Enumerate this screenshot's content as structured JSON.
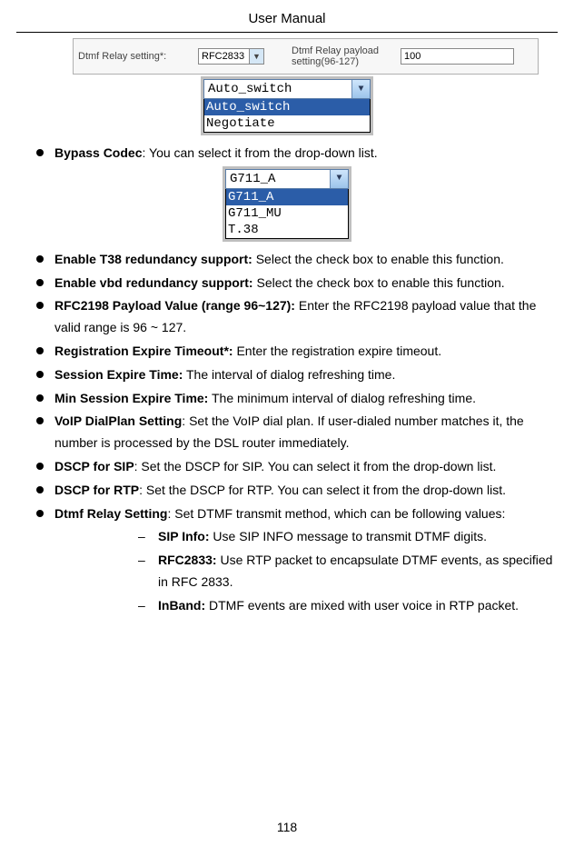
{
  "header": {
    "title": "User Manual"
  },
  "dtmf_row": {
    "label1": "Dtmf Relay setting*:",
    "select_value": "RFC2833",
    "label2": "Dtmf Relay payload setting(96-127)",
    "input_value": "100"
  },
  "dropdown_auto": {
    "header": "Auto_switch",
    "items": [
      "Auto_switch",
      "Negotiate"
    ],
    "selected_index": 0
  },
  "dropdown_codec": {
    "header": "G711_A",
    "items": [
      "G711_A",
      "G711_MU",
      "T.38"
    ],
    "selected_index": 0
  },
  "bullets": [
    {
      "bold": "Bypass Codec",
      "text": ": You can select it from the drop-down list."
    },
    {
      "bold": "Enable T38 redundancy support:",
      "text": " Select the check box to enable this function."
    },
    {
      "bold": "Enable vbd redundancy support:",
      "text": " Select the check box to enable this function."
    },
    {
      "bold": "RFC2198 Payload Value (range 96~127):",
      "text": " Enter the RFC2198 payload value that the valid range is 96 ~ 127."
    },
    {
      "bold": "Registration Expire Timeout*:",
      "text": " Enter the registration expire timeout."
    },
    {
      "bold": "Session Expire Time:",
      "text": " The interval of dialog refreshing time."
    },
    {
      "bold": "Min Session Expire Time:",
      "text": " The minimum interval of dialog refreshing time."
    },
    {
      "bold": "VoIP DialPlan Setting",
      "text": ": Set the VoIP dial plan. If user-dialed number matches it, the number is processed by the DSL router immediately."
    },
    {
      "bold": "DSCP for SIP",
      "text": ": Set the DSCP for SIP. You can select it from the drop-down list."
    },
    {
      "bold": "DSCP for RTP",
      "text": ": Set the DSCP for RTP. You can select it from the drop-down list."
    },
    {
      "bold": "Dtmf Relay Setting",
      "text": ": Set DTMF transmit method, which can be following values:"
    }
  ],
  "sub_bullets": [
    {
      "bold": "SIP Info:",
      "text": " Use SIP INFO message to transmit DTMF digits."
    },
    {
      "bold": "RFC2833:",
      "text": " Use RTP packet to encapsulate DTMF events, as specified in RFC 2833."
    },
    {
      "bold": "InBand:",
      "text": " DTMF events are mixed with user voice in RTP packet."
    }
  ],
  "page_number": "118"
}
